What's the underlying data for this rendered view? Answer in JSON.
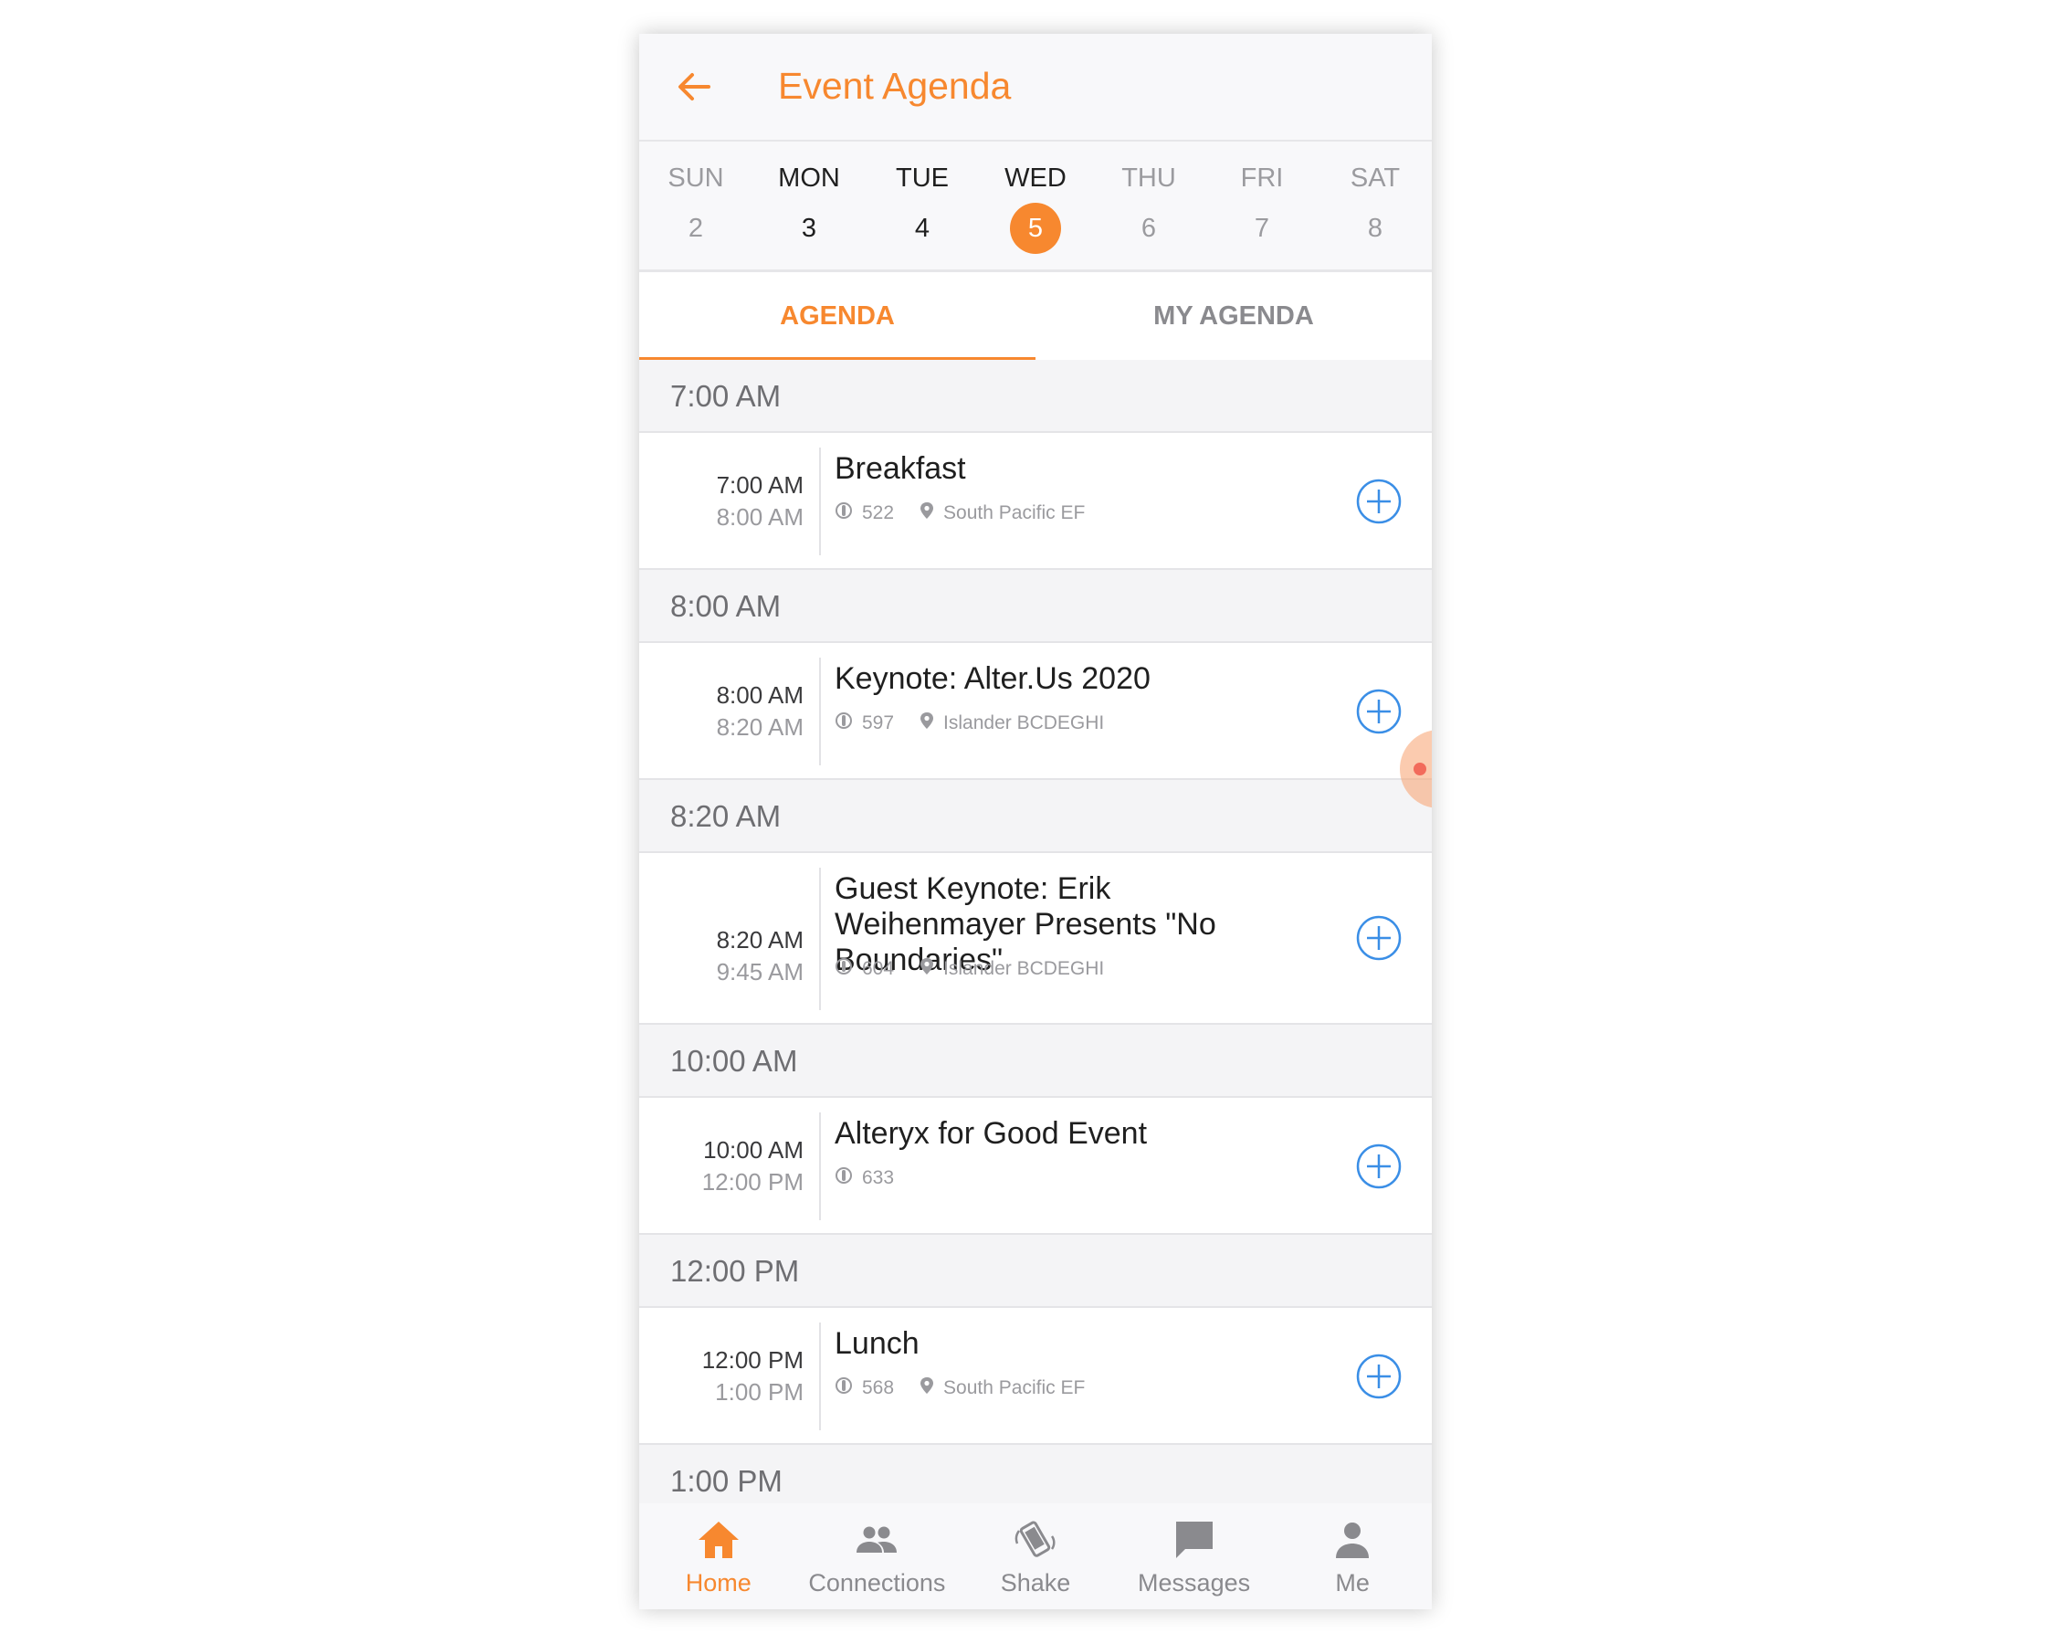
{
  "appbar": {
    "title": "Event Agenda",
    "back_icon": "arrow-left-icon"
  },
  "days": [
    {
      "name": "SUN",
      "num": "2",
      "state": "inactive"
    },
    {
      "name": "MON",
      "num": "3",
      "state": "active"
    },
    {
      "name": "TUE",
      "num": "4",
      "state": "active"
    },
    {
      "name": "WED",
      "num": "5",
      "state": "selected"
    },
    {
      "name": "THU",
      "num": "6",
      "state": "inactive"
    },
    {
      "name": "FRI",
      "num": "7",
      "state": "inactive"
    },
    {
      "name": "SAT",
      "num": "8",
      "state": "inactive"
    }
  ],
  "tabs": {
    "agenda": "AGENDA",
    "my_agenda": "MY AGENDA"
  },
  "slots": [
    {
      "label": "7:00 AM"
    },
    {
      "label": "8:00 AM"
    },
    {
      "label": "8:20 AM"
    },
    {
      "label": "10:00 AM"
    },
    {
      "label": "12:00 PM"
    },
    {
      "label": "1:00 PM"
    }
  ],
  "sessions": [
    {
      "start": "7:00 AM",
      "end": "8:00 AM",
      "title": "Breakfast",
      "attendees": "522",
      "location": "South Pacific EF"
    },
    {
      "start": "8:00 AM",
      "end": "8:20 AM",
      "title": "Keynote: Alter.Us 2020",
      "attendees": "597",
      "location": "Islander BCDEGHI"
    },
    {
      "start": "8:20 AM",
      "end": "9:45 AM",
      "title": "Guest Keynote: Erik Weihenmayer Presents \"No Boundaries\"",
      "attendees": "604",
      "location": "Islander BCDEGHI"
    },
    {
      "start": "10:00 AM",
      "end": "12:00 PM",
      "title": "Alteryx for Good Event",
      "attendees": "633",
      "location": ""
    },
    {
      "start": "12:00 PM",
      "end": "1:00 PM",
      "title": "Lunch",
      "attendees": "568",
      "location": "South Pacific EF"
    }
  ],
  "nav": [
    {
      "label": "Home",
      "icon": "home-icon",
      "active": true
    },
    {
      "label": "Connections",
      "icon": "people-icon",
      "active": false
    },
    {
      "label": "Shake",
      "icon": "shake-phone-icon",
      "active": false
    },
    {
      "label": "Messages",
      "icon": "chat-icon",
      "active": false
    },
    {
      "label": "Me",
      "icon": "person-icon",
      "active": false
    }
  ],
  "colors": {
    "accent": "#f7882f",
    "add_button": "#3a8ee6",
    "muted": "#9a9a9e"
  }
}
